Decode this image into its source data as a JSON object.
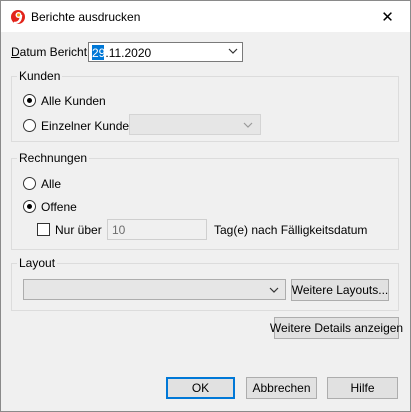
{
  "window": {
    "title": "Berichte ausdrucken",
    "close_glyph": "✕",
    "app_icon": "banana-logo-icon",
    "colors": {
      "accent": "#0078d7",
      "logo_red": "#e2231a",
      "logo_orange": "#f6a01a"
    }
  },
  "date": {
    "label": "Datum Bericht",
    "value_selected": "29",
    "value_rest": ".11.2020"
  },
  "kunden": {
    "title": "Kunden",
    "all_label": "Alle Kunden",
    "single_label": "Einzelner Kunde",
    "selected": "all"
  },
  "rechnungen": {
    "title": "Rechnungen",
    "all_label": "Alle",
    "open_label": "Offene",
    "selected": "open",
    "only_over_label": "Nur über",
    "days_value": "10",
    "days_suffix": "Tag(e) nach Fälligkeitsdatum"
  },
  "layout": {
    "title": "Layout",
    "more_layouts_label": "Weitere Layouts..."
  },
  "buttons": {
    "more_details": "Weitere Details anzeigen",
    "ok": "OK",
    "cancel": "Abbrechen",
    "help": "Hilfe"
  }
}
